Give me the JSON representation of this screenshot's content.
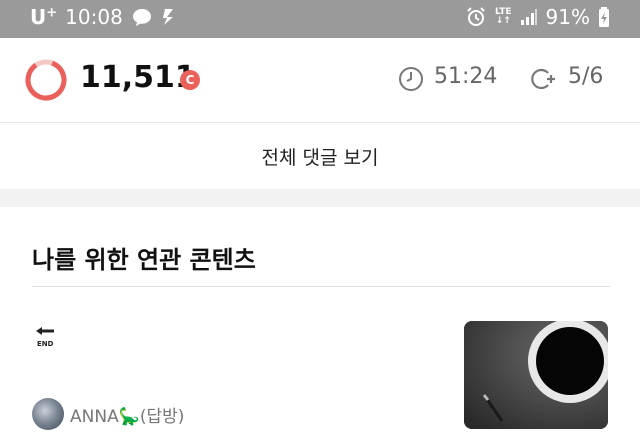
{
  "status_bar": {
    "carrier": "U",
    "carrier_super": "+",
    "time": "10:08",
    "network_top": "LTE",
    "battery": "91%",
    "icons": [
      "chat-bubble-icon",
      "notification-icon",
      "alarm-icon",
      "lte-signal-icon",
      "signal-bars-icon",
      "battery-charging-icon"
    ]
  },
  "header": {
    "points": "11,511",
    "coin_label": "C",
    "timer": "51:24",
    "count": "5/6",
    "colors": {
      "accent": "#e9615a",
      "muted": "#666666"
    }
  },
  "comments": {
    "view_all_label": "전체 댓글 보기"
  },
  "related": {
    "title": "나를 위한 연관 콘텐츠",
    "items": [
      {
        "author": "ANNA🦕(답방)",
        "thumbnail": "coffee-cup-image"
      }
    ]
  }
}
